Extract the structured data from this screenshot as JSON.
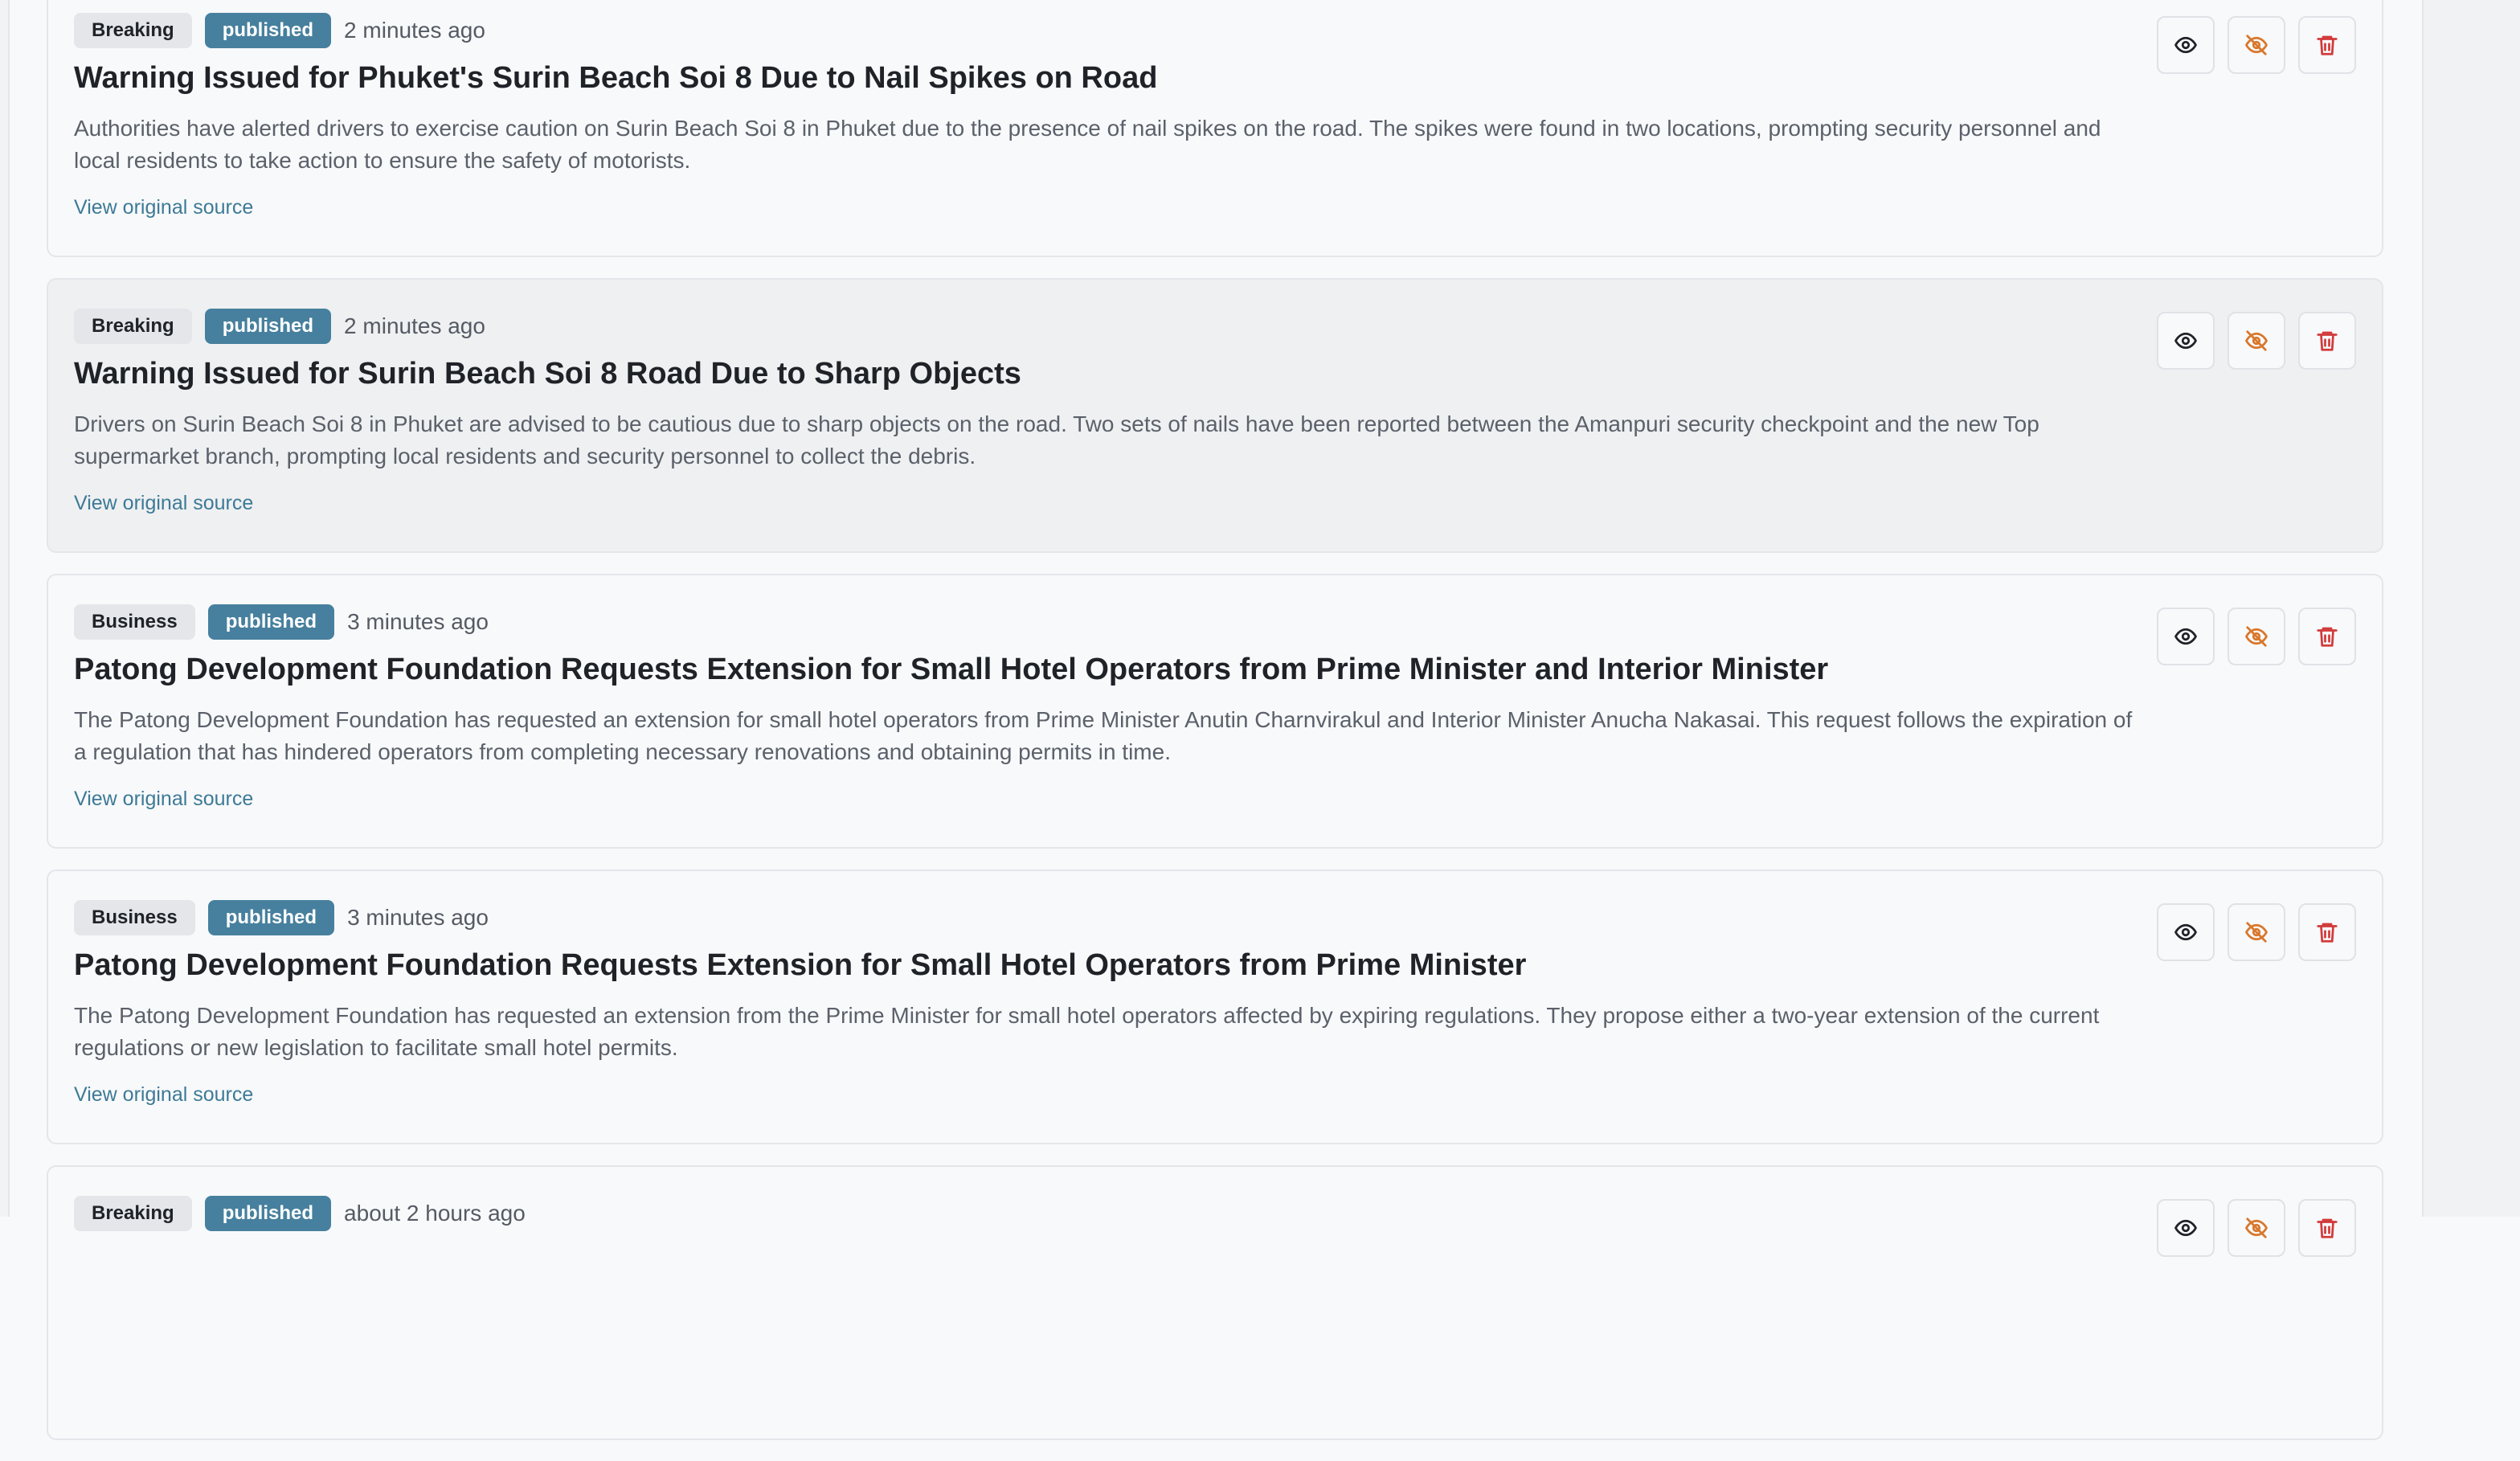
{
  "colors": {
    "status_published": "#47809e",
    "link": "#3d7a96",
    "hide_icon": "#d9772b",
    "delete_icon": "#d23b3b"
  },
  "articles": [
    {
      "category": "Breaking",
      "status": "published",
      "time": "2 minutes ago",
      "title": "Warning Issued for Phuket's Surin Beach Soi 8 Due to Nail Spikes on Road",
      "summary": "Authorities have alerted drivers to exercise caution on Surin Beach Soi 8 in Phuket due to the presence of nail spikes on the road. The spikes were found in two locations, prompting security personnel and local residents to take action to ensure the safety of motorists.",
      "source_label": "View original source"
    },
    {
      "category": "Breaking",
      "status": "published",
      "time": "2 minutes ago",
      "title": "Warning Issued for Surin Beach Soi 8 Road Due to Sharp Objects",
      "summary": "Drivers on Surin Beach Soi 8 in Phuket are advised to be cautious due to sharp objects on the road. Two sets of nails have been reported between the Amanpuri security checkpoint and the new Top supermarket branch, prompting local residents and security personnel to collect the debris.",
      "source_label": "View original source"
    },
    {
      "category": "Business",
      "status": "published",
      "time": "3 minutes ago",
      "title": "Patong Development Foundation Requests Extension for Small Hotel Operators from Prime Minister and Interior Minister",
      "summary": "The Patong Development Foundation has requested an extension for small hotel operators from Prime Minister Anutin Charnvirakul and Interior Minister Anucha Nakasai. This request follows the expiration of a regulation that has hindered operators from completing necessary renovations and obtaining permits in time.",
      "source_label": "View original source"
    },
    {
      "category": "Business",
      "status": "published",
      "time": "3 minutes ago",
      "title": "Patong Development Foundation Requests Extension for Small Hotel Operators from Prime Minister",
      "summary": "The Patong Development Foundation has requested an extension from the Prime Minister for small hotel operators affected by expiring regulations. They propose either a two-year extension of the current regulations or new legislation to facilitate small hotel permits.",
      "source_label": "View original source"
    },
    {
      "category": "Breaking",
      "status": "published",
      "time": "about 2 hours ago",
      "title": "",
      "summary": "",
      "source_label": ""
    }
  ]
}
